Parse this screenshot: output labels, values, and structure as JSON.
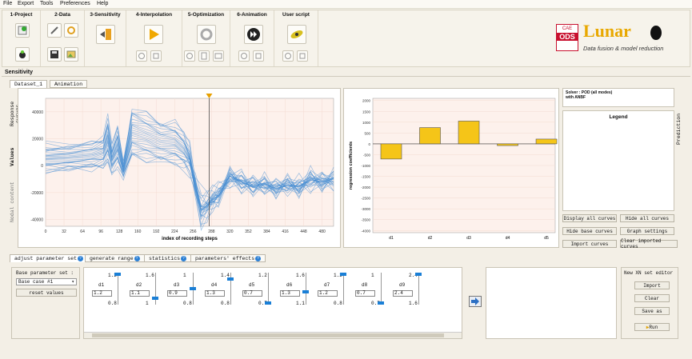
{
  "menu": [
    "File",
    "Export",
    "Tools",
    "Preferences",
    "Help"
  ],
  "toolbar": {
    "groups": [
      "1-Project",
      "2-Data",
      "3-Sensitivity",
      "4-Interpolation",
      "5-Optimization",
      "6-Animation",
      "User script"
    ]
  },
  "logo": {
    "badge_top": "CAE",
    "badge_main": "ODS",
    "name": "Lunar",
    "tagline": "Data fusion & model reduction",
    "colors": {
      "red": "#c8102e",
      "gold": "#e8a800"
    }
  },
  "section_title": "Sensitivity",
  "tabs": [
    "Dataset_1",
    "Animation"
  ],
  "left_side_tabs": [
    "Response curves",
    "Values",
    "Nodal content"
  ],
  "right_side_tab": "Prediction",
  "chart_main": {
    "type": "line",
    "xlabel": "index of recording steps",
    "xticks": [
      "0",
      "32",
      "64",
      "96",
      "128",
      "160",
      "192",
      "224",
      "256",
      "288",
      "320",
      "352",
      "384",
      "416",
      "448",
      "480"
    ],
    "yticks": [
      "40000",
      "20000",
      "0",
      "-20000",
      "-40000"
    ],
    "ylim": [
      -45000,
      50000
    ],
    "xlim": [
      0,
      500
    ],
    "series_color": "#4a8fd4",
    "mean_curve": [
      [
        0,
        6000
      ],
      [
        40,
        6500
      ],
      [
        80,
        8000
      ],
      [
        100,
        10000
      ],
      [
        108,
        20000
      ],
      [
        115,
        5000
      ],
      [
        125,
        15000
      ],
      [
        135,
        -3000
      ],
      [
        150,
        25000
      ],
      [
        175,
        22000
      ],
      [
        200,
        18000
      ],
      [
        225,
        17000
      ],
      [
        240,
        12000
      ],
      [
        250,
        5000
      ],
      [
        260,
        -15000
      ],
      [
        270,
        -33000
      ],
      [
        280,
        -30000
      ],
      [
        290,
        -25000
      ],
      [
        300,
        -22000
      ],
      [
        320,
        -8000
      ],
      [
        340,
        -12000
      ],
      [
        360,
        -15000
      ],
      [
        380,
        -14000
      ],
      [
        400,
        -17000
      ],
      [
        420,
        -14000
      ],
      [
        440,
        -16000
      ],
      [
        460,
        -10000
      ],
      [
        480,
        -12000
      ],
      [
        500,
        -10000
      ]
    ],
    "marker_x": 284
  },
  "chart_reg": {
    "type": "bar",
    "ylabel": "regression coefficients",
    "categories": [
      "d1",
      "d2",
      "d3",
      "d4",
      "d5"
    ],
    "values": [
      -700,
      750,
      1050,
      -80,
      220
    ],
    "yticks": [
      "2000",
      "1500",
      "1000",
      "500",
      "0",
      "-500",
      "-1000",
      "-1500",
      "-2000",
      "-2500",
      "-3000",
      "-3500",
      "-4000"
    ],
    "ylim": [
      -4100,
      2100
    ],
    "bar_color": "#f5c518"
  },
  "solver_info": {
    "line1": "Solver : POD (all modes)",
    "line2": "with ANBF"
  },
  "legend_title": "Legend",
  "curve_buttons": [
    "Display all curves",
    "Hide all curves",
    "Hide base curves",
    "Graph settings",
    "Import curves",
    "Clear imported curves"
  ],
  "bottom_tabs": [
    "adjust parameter set",
    "generate range",
    "statistics",
    "parameters' effects"
  ],
  "param_set": {
    "label": "Base parameter set :",
    "selected": "Base case #1",
    "reset": "reset values"
  },
  "params": [
    {
      "name": "d1",
      "max": "1.2",
      "value": "1.2",
      "min": "0.8",
      "level": 1.0
    },
    {
      "name": "d2",
      "max": "1.6",
      "value": "1.1",
      "min": "1",
      "level": 0.17
    },
    {
      "name": "d3",
      "max": "1",
      "value": "0.9",
      "min": "0.8",
      "level": 0.5
    },
    {
      "name": "d4",
      "max": "1.4",
      "value": "1.3",
      "min": "0.8",
      "level": 0.83
    },
    {
      "name": "d5",
      "max": "1.2",
      "value": "0.7",
      "min": "0.7",
      "level": 0.0
    },
    {
      "name": "d6",
      "max": "1.6",
      "value": "1.3",
      "min": "1.1",
      "level": 0.4
    },
    {
      "name": "d7",
      "max": "1.2",
      "value": "1.2",
      "min": "0.8",
      "level": 1.0
    },
    {
      "name": "d8",
      "max": "1",
      "value": "0.7",
      "min": "0.7",
      "level": 0.0
    },
    {
      "name": "d9",
      "max": "2.4",
      "value": "2.4",
      "min": "1.6",
      "level": 1.0
    }
  ],
  "xn_editor": {
    "title": "New XN set editor",
    "buttons": [
      "Import",
      "Clear",
      "Save as",
      "Run"
    ]
  }
}
